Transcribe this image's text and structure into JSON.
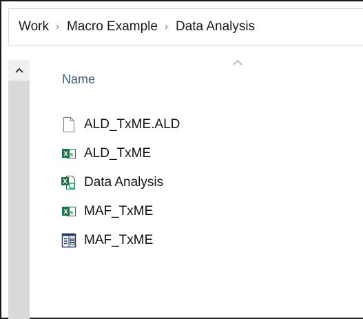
{
  "breadcrumb": {
    "items": [
      "Work",
      "Macro Example",
      "Data Analysis"
    ],
    "separator": "›"
  },
  "columns": {
    "name_header": "Name",
    "sort_direction": "ascending"
  },
  "files": [
    {
      "name": "ALD_TxME.ALD",
      "icon": "generic-file-icon"
    },
    {
      "name": "ALD_TxME",
      "icon": "excel-file-icon"
    },
    {
      "name": "Data Analysis",
      "icon": "excel-macro-file-icon"
    },
    {
      "name": "MAF_TxME",
      "icon": "excel-file-icon"
    },
    {
      "name": "MAF_TxME",
      "icon": "data-form-file-icon"
    }
  ],
  "colors": {
    "header_text": "#3a5a80",
    "excel_green": "#1e7145",
    "scrollbar": "#d9d9d9"
  }
}
